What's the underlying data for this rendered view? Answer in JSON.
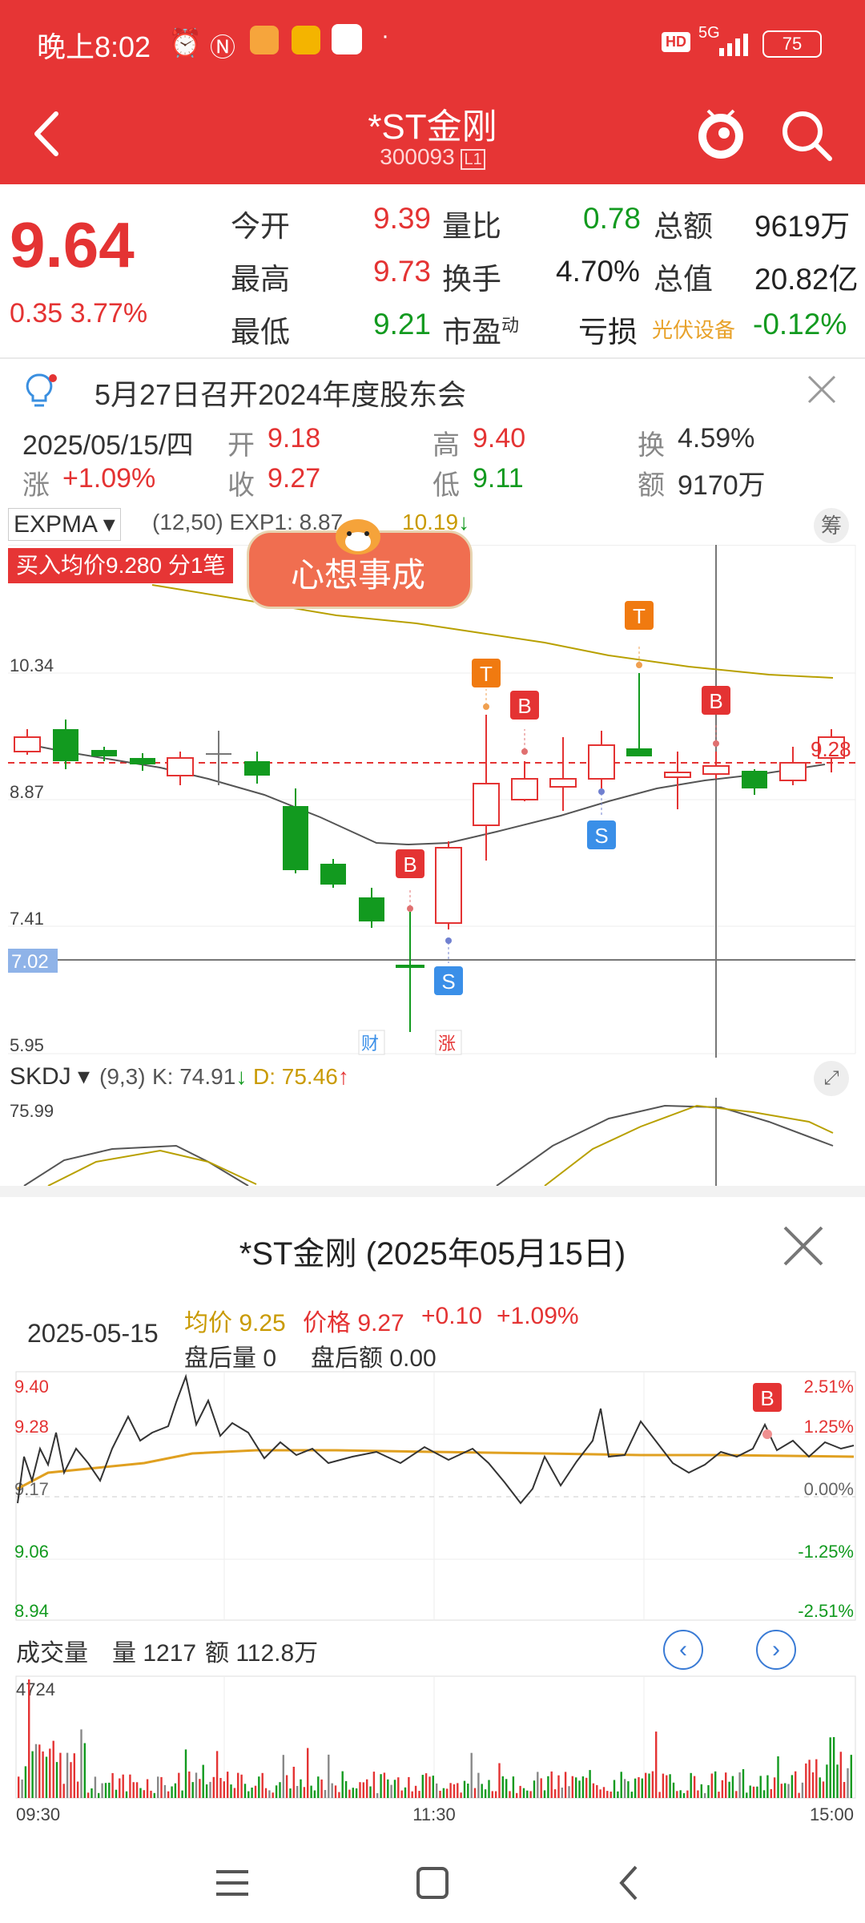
{
  "status_bar": {
    "time": "晚上8:02",
    "network": "5G",
    "battery": "75"
  },
  "header": {
    "title": "*ST金刚",
    "code": "300093",
    "level_badge": "L1"
  },
  "quote": {
    "price": "9.64",
    "change": "0.35",
    "change_pct": "3.77%",
    "rows": [
      [
        {
          "label": "今开",
          "value": "9.39",
          "color": "red"
        },
        {
          "label": "量比",
          "value": "0.78",
          "color": "green"
        },
        {
          "label": "总额",
          "value": "9619万",
          "color": "black"
        }
      ],
      [
        {
          "label": "最高",
          "value": "9.73",
          "color": "red"
        },
        {
          "label": "换手",
          "value": "4.70%",
          "color": "black"
        },
        {
          "label": "总值",
          "value": "20.82亿",
          "color": "black"
        }
      ],
      [
        {
          "label": "最低",
          "value": "9.21",
          "color": "green"
        },
        {
          "label": "市盈",
          "label_sup": "动",
          "value": "亏损",
          "color": "black"
        },
        {
          "label": "光伏设备",
          "value": "-0.12%",
          "color": "green"
        }
      ]
    ]
  },
  "notice": {
    "text": "5月27日召开2024年度股东会"
  },
  "day_info": {
    "date": "2025/05/15/四",
    "open_label": "开",
    "open": "9.18",
    "high_label": "高",
    "high": "9.40",
    "turnover_label": "换",
    "turnover": "4.59%",
    "change_label": "涨",
    "change": "+1.09%",
    "close_label": "收",
    "close": "9.27",
    "low_label": "低",
    "low": "9.11",
    "amount_label": "额",
    "amount": "9170万"
  },
  "kline": {
    "indicator": "EXPMA",
    "params": "(12,50) EXP1: 8.87",
    "exp2_value": "10.19",
    "chip_button": "筹",
    "buy_avg_banner": "买入均价9.280 分1笔",
    "sticker_text": "心想事成",
    "y_labels": [
      "10.34",
      "8.87",
      "7.41",
      "7.02",
      "5.95"
    ],
    "last_price_label": "9.28",
    "markers": [
      "财",
      "涨"
    ],
    "signals": [
      "T",
      "B",
      "S"
    ]
  },
  "skdj": {
    "name": "SKDJ",
    "params": "(9,3)",
    "k_label": "K: 74.91",
    "d_label": "D: 75.46",
    "y_top": "75.99"
  },
  "intraday": {
    "title": "*ST金刚 (2025年05月15日)",
    "date": "2025-05-15",
    "avg_label": "均价 9.25",
    "price_label": "价格 9.27",
    "change": "+0.10",
    "change_pct": "+1.09%",
    "after_vol_label": "盘后量 0",
    "after_amt_label": "盘后额 0.00",
    "left_ticks": [
      "9.40",
      "9.28",
      "9.17",
      "9.06",
      "8.94"
    ],
    "right_ticks": [
      "2.51%",
      "1.25%",
      "0.00%",
      "-1.25%",
      "-2.51%"
    ],
    "volume_title": "成交量",
    "volume_qty": "量 1217",
    "volume_amt": "额 112.8万",
    "volume_max": "4724",
    "time_labels": [
      "09:30",
      "11:30",
      "15:00"
    ]
  },
  "colors": {
    "brand_red": "#e63535",
    "up": "#e43333",
    "down": "#129a1f",
    "avg_line": "#e0a020"
  }
}
